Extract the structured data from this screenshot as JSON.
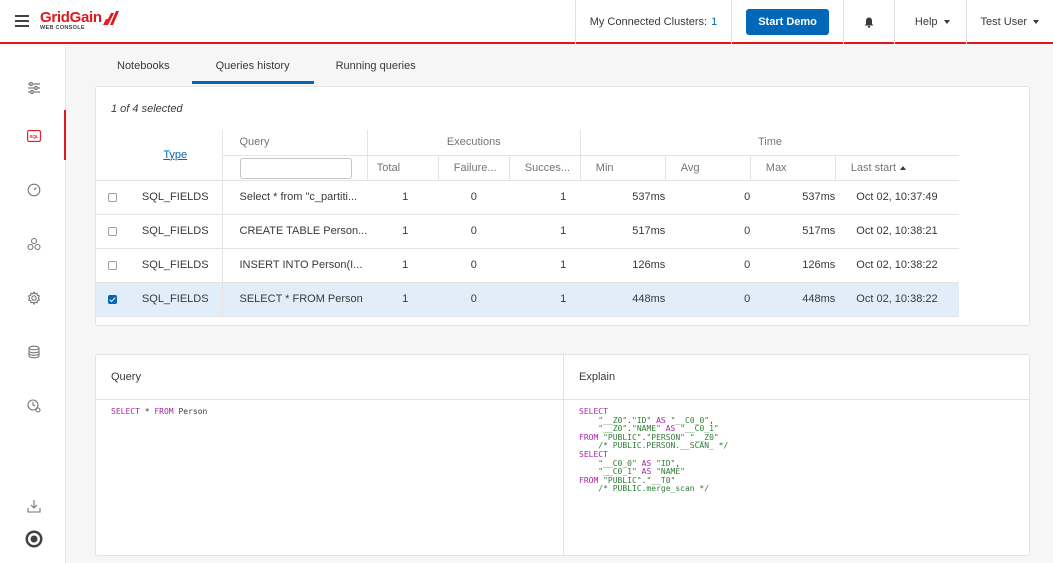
{
  "header": {
    "logo_main": "GridGain",
    "logo_sub": "WEB CONSOLE",
    "clusters_label": "My Connected Clusters:",
    "clusters_count": "1",
    "start_demo": "Start Demo",
    "help": "Help",
    "user": "Test User"
  },
  "sidebar": {
    "items": [
      "configuration",
      "queries",
      "monitoring",
      "cluster",
      "settings",
      "snapshots",
      "history"
    ],
    "active": "queries"
  },
  "tabs": [
    {
      "label": "Notebooks",
      "active": false
    },
    {
      "label": "Queries history",
      "active": true
    },
    {
      "label": "Running queries",
      "active": false
    }
  ],
  "queries": {
    "selected_text": "1 of 4 selected",
    "headers": {
      "type": "Type",
      "query": "Query",
      "executions": "Executions",
      "time": "Time",
      "total": "Total",
      "failures": "Failure...",
      "success": "Succes...",
      "min": "Min",
      "avg": "Avg",
      "max": "Max",
      "last_start": "Last start"
    },
    "rows": [
      {
        "type": "SQL_FIELDS",
        "query": "Select * from \"c_partiti...",
        "total": "1",
        "failures": "0",
        "success": "1",
        "min": "537ms",
        "avg": "0",
        "max": "537ms",
        "last_start": "Oct 02, 10:37:49",
        "checked": false
      },
      {
        "type": "SQL_FIELDS",
        "query": "CREATE TABLE Person...",
        "total": "1",
        "failures": "0",
        "success": "1",
        "min": "517ms",
        "avg": "0",
        "max": "517ms",
        "last_start": "Oct 02, 10:38:21",
        "checked": false
      },
      {
        "type": "SQL_FIELDS",
        "query": "INSERT INTO Person(I...",
        "total": "1",
        "failures": "0",
        "success": "1",
        "min": "126ms",
        "avg": "0",
        "max": "126ms",
        "last_start": "Oct 02, 10:38:22",
        "checked": false
      },
      {
        "type": "SQL_FIELDS",
        "query": "SELECT * FROM Person",
        "total": "1",
        "failures": "0",
        "success": "1",
        "min": "448ms",
        "avg": "0",
        "max": "448ms",
        "last_start": "Oct 02, 10:38:22",
        "checked": true
      }
    ]
  },
  "details": {
    "query_title": "Query",
    "explain_title": "Explain",
    "query_text": "SELECT * FROM Person",
    "explain_lines": [
      "SELECT",
      "    \"__Z0\".\"ID\" AS \"__C0_0\",",
      "    \"__Z0\".\"NAME\" AS \"__C0_1\"",
      "FROM \"PUBLIC\".\"PERSON\" \"__Z0\"",
      "    /* PUBLIC.PERSON.__SCAN_ */",
      "SELECT",
      "    \"__C0_0\" AS \"ID\",",
      "    \"__C0_1\" AS \"NAME\"",
      "FROM \"PUBLIC\".\"__T0\"",
      "    /* PUBLIC.merge_scan */"
    ]
  },
  "colors": {
    "brand_red": "#e4161c",
    "primary_blue": "#0067b9",
    "selected_row": "#e1eef9"
  }
}
